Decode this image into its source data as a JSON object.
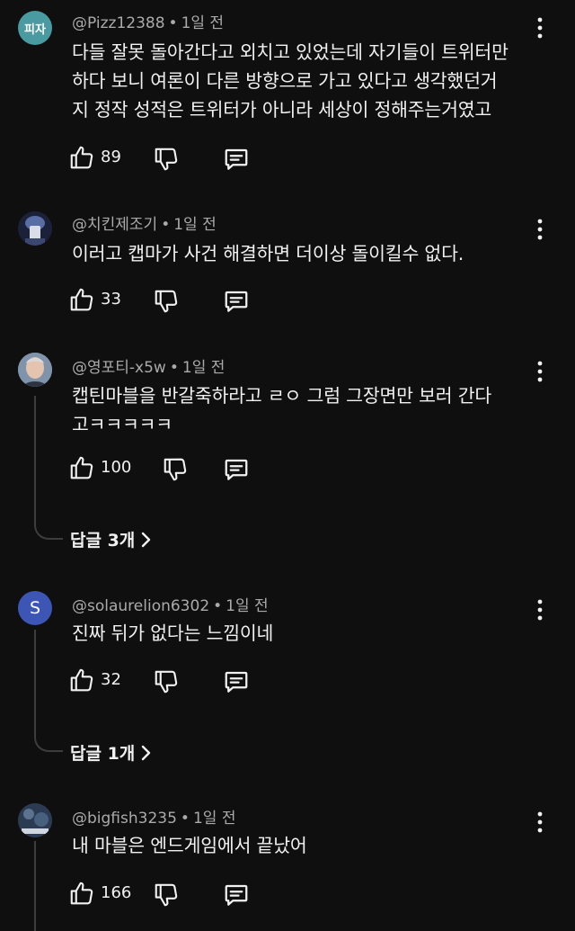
{
  "comments": [
    {
      "avatar_text": "피자",
      "avatar_bg": "#4a9aa2",
      "handle": "@Pizz12388",
      "time": "1일 전",
      "text": "다들 잘못 돌아간다고 외치고 있었는데 자기들이 트위터만\n하다 보니 여론이 다른 방향으로 가고 있다고 생각했던거\n지 정작 성적은 트위터가 아니라 세상이 정해주는거였고",
      "likes": "89"
    },
    {
      "avatar_text": "",
      "avatar_bg": "#1b2138",
      "handle": "@치킨제조기",
      "time": "1일 전",
      "text": "이러고 캡마가 사건 해결하면 더이상 돌이킬수 없다.",
      "likes": "33"
    },
    {
      "avatar_text": "",
      "avatar_bg": "#8d9db0",
      "handle": "@영포티-x5w",
      "time": "1일 전",
      "text": "캡틴마블을 반갈죽하라고 ㄹㅇ 그럼  그장면만 보러 간다\n고ㅋㅋㅋㅋㅋ",
      "likes": "100",
      "replies_label": "답글 3개"
    },
    {
      "avatar_text": "S",
      "avatar_bg": "#3d55b5",
      "handle": "@solaurelion6302",
      "time": "1일 전",
      "text": "진짜 뒤가 없다는 느낌이네",
      "likes": "32",
      "replies_label": "답글 1개"
    },
    {
      "avatar_text": "",
      "avatar_bg": "#2b3b52",
      "handle": "@bigfish3235",
      "time": "1일 전",
      "text": "내 마블은 엔드게임에서 끝났어",
      "likes": "166"
    }
  ],
  "icons": {
    "like": "thumb-up-icon",
    "dislike": "thumb-down-icon",
    "reply": "comment-icon",
    "more": "more-vertical-icon",
    "chevron": "chevron-right-icon"
  }
}
